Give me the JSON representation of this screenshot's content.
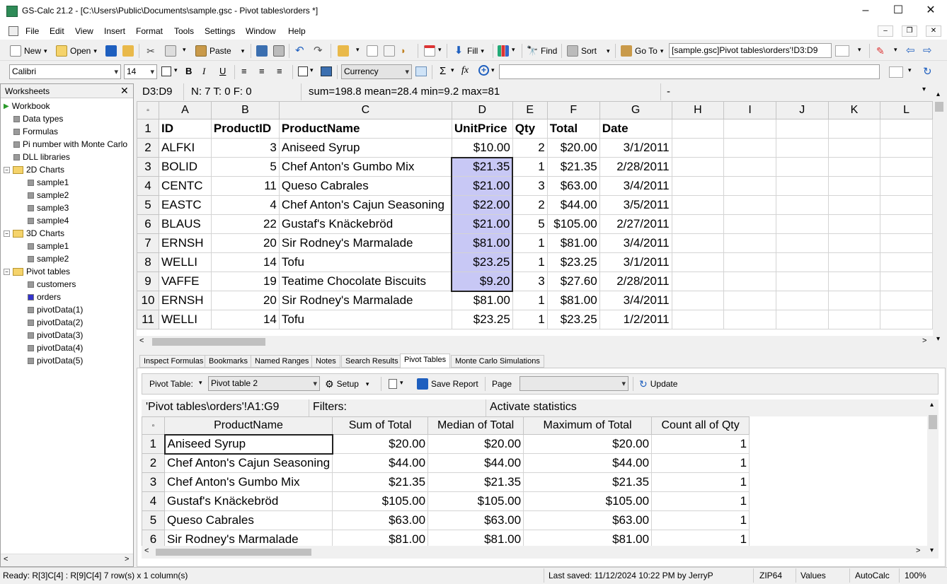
{
  "window": {
    "title": "GS-Calc 21.2 - [C:\\Users\\Public\\Documents\\sample.gsc - Pivot tables\\orders *]"
  },
  "menu": [
    "File",
    "Edit",
    "View",
    "Insert",
    "Format",
    "Tools",
    "Settings",
    "Window",
    "Help"
  ],
  "toolbar": {
    "new": "New",
    "open": "Open",
    "paste": "Paste",
    "fill": "Fill",
    "find": "Find",
    "sort": "Sort",
    "goto": "Go To",
    "address": "[sample.gsc]Pivot tables\\orders'!D3:D9",
    "font": "Calibri",
    "size": "14",
    "number_format": "Currency",
    "sigma": "Σ",
    "fx": "fx"
  },
  "worksheets": {
    "title": "Worksheets",
    "items": [
      {
        "label": "Workbook",
        "type": "root"
      },
      {
        "label": "Data types",
        "type": "sheet",
        "level": 1
      },
      {
        "label": "Formulas",
        "type": "sheet",
        "level": 1
      },
      {
        "label": "Pi number with Monte Carlo",
        "type": "sheet",
        "level": 1
      },
      {
        "label": "DLL libraries",
        "type": "sheet",
        "level": 1
      },
      {
        "label": "2D Charts",
        "type": "folder",
        "level": 1
      },
      {
        "label": "sample1",
        "type": "sheet",
        "level": 2
      },
      {
        "label": "sample2",
        "type": "sheet",
        "level": 2
      },
      {
        "label": "sample3",
        "type": "sheet",
        "level": 2
      },
      {
        "label": "sample4",
        "type": "sheet",
        "level": 2
      },
      {
        "label": "3D Charts",
        "type": "folder",
        "level": 1
      },
      {
        "label": "sample1",
        "type": "sheet",
        "level": 2
      },
      {
        "label": "sample2",
        "type": "sheet",
        "level": 2
      },
      {
        "label": "Pivot tables",
        "type": "folder",
        "level": 1
      },
      {
        "label": "customers",
        "type": "sheet",
        "level": 2
      },
      {
        "label": "orders",
        "type": "sheet",
        "level": 2,
        "selected": true
      },
      {
        "label": "pivotData(1)",
        "type": "sheet",
        "level": 2
      },
      {
        "label": "pivotData(2)",
        "type": "sheet",
        "level": 2
      },
      {
        "label": "pivotData(3)",
        "type": "sheet",
        "level": 2
      },
      {
        "label": "pivotData(4)",
        "type": "sheet",
        "level": 2
      },
      {
        "label": "pivotData(5)",
        "type": "sheet",
        "level": 2
      }
    ]
  },
  "formula_bar": {
    "range": "D3:D9",
    "counts": "N: 7  T: 0  F: 0",
    "stats": "sum=198.8  mean=28.4  min=9.2  max=81",
    "value": "-"
  },
  "grid": {
    "columns": [
      "A",
      "B",
      "C",
      "D",
      "E",
      "F",
      "G",
      "H",
      "I",
      "J",
      "K",
      "L"
    ],
    "rows": [
      {
        "n": "1",
        "cells": [
          "ID",
          "ProductID",
          "ProductName",
          "UnitPrice",
          "Qty",
          "Total",
          "Date"
        ]
      },
      {
        "n": "2",
        "cells": [
          "ALFKI",
          "3",
          "Aniseed Syrup",
          "$10.00",
          "2",
          "$20.00",
          "3/1/2011"
        ]
      },
      {
        "n": "3",
        "cells": [
          "BOLID",
          "5",
          "Chef Anton's Gumbo Mix",
          "$21.35",
          "1",
          "$21.35",
          "2/28/2011"
        ]
      },
      {
        "n": "4",
        "cells": [
          "CENTC",
          "11",
          "Queso Cabrales",
          "$21.00",
          "3",
          "$63.00",
          "3/4/2011"
        ]
      },
      {
        "n": "5",
        "cells": [
          "EASTC",
          "4",
          "Chef Anton's Cajun Seasoning",
          "$22.00",
          "2",
          "$44.00",
          "3/5/2011"
        ]
      },
      {
        "n": "6",
        "cells": [
          "BLAUS",
          "22",
          "Gustaf's Knäckebröd",
          "$21.00",
          "5",
          "$105.00",
          "2/27/2011"
        ]
      },
      {
        "n": "7",
        "cells": [
          "ERNSH",
          "20",
          "Sir Rodney's Marmalade",
          "$81.00",
          "1",
          "$81.00",
          "3/4/2011"
        ]
      },
      {
        "n": "8",
        "cells": [
          "WELLI",
          "14",
          "Tofu",
          "$23.25",
          "1",
          "$23.25",
          "3/1/2011"
        ]
      },
      {
        "n": "9",
        "cells": [
          "VAFFE",
          "19",
          "Teatime Chocolate Biscuits",
          "$9.20",
          "3",
          "$27.60",
          "2/28/2011"
        ]
      },
      {
        "n": "10",
        "cells": [
          "ERNSH",
          "20",
          "Sir Rodney's Marmalade",
          "$81.00",
          "1",
          "$81.00",
          "3/4/2011"
        ]
      },
      {
        "n": "11",
        "cells": [
          "WELLI",
          "14",
          "Tofu",
          "$23.25",
          "1",
          "$23.25",
          "1/2/2011"
        ]
      }
    ]
  },
  "bottom_tabs": [
    "Inspect Formulas",
    "Bookmarks",
    "Named Ranges",
    "Notes",
    "Search Results",
    "Pivot Tables",
    "Monte Carlo Simulations"
  ],
  "pivot": {
    "label": "Pivot Table:",
    "table": "Pivot table 2",
    "setup": "Setup",
    "save_report": "Save Report",
    "page": "Page",
    "update": "Update",
    "source": "'Pivot tables\\orders'!A1:G9",
    "filters": "Filters:",
    "activate": "Activate statistics",
    "headers": [
      "ProductName",
      "Sum of Total",
      "Median of Total",
      "Maximum of Total",
      "Count all of Qty"
    ],
    "rows": [
      {
        "n": "1",
        "cells": [
          "Aniseed Syrup",
          "$20.00",
          "$20.00",
          "$20.00",
          "1"
        ]
      },
      {
        "n": "2",
        "cells": [
          "Chef Anton's Cajun Seasoning",
          "$44.00",
          "$44.00",
          "$44.00",
          "1"
        ]
      },
      {
        "n": "3",
        "cells": [
          "Chef Anton's Gumbo Mix",
          "$21.35",
          "$21.35",
          "$21.35",
          "1"
        ]
      },
      {
        "n": "4",
        "cells": [
          "Gustaf's Knäckebröd",
          "$105.00",
          "$105.00",
          "$105.00",
          "1"
        ]
      },
      {
        "n": "5",
        "cells": [
          "Queso Cabrales",
          "$63.00",
          "$63.00",
          "$63.00",
          "1"
        ]
      },
      {
        "n": "6",
        "cells": [
          "Sir Rodney's Marmalade",
          "$81.00",
          "$81.00",
          "$81.00",
          "1"
        ]
      }
    ]
  },
  "status": {
    "ready": "Ready:  R[3]C[4] : R[9]C[4]    7 row(s) x 1 column(s)",
    "saved": "Last saved:  11/12/2024 10:22 PM  by  JerryP",
    "zip": "ZIP64",
    "values": "Values",
    "autocalc": "AutoCalc",
    "zoom": "100%"
  },
  "colors": {
    "selection": "#c8c8f5",
    "accent": "#1e5fbf"
  }
}
